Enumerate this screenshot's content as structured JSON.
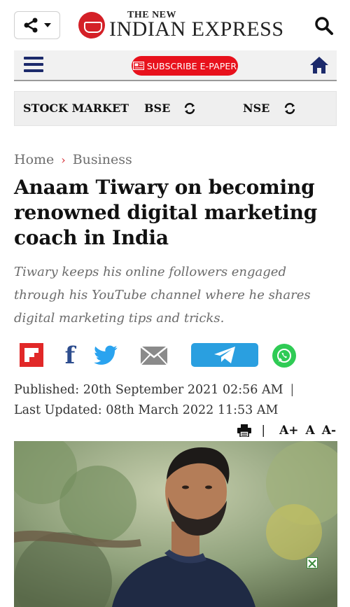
{
  "header": {
    "logo_top": "THE NEW",
    "logo_main": "INDIAN EXPRESS"
  },
  "navbar": {
    "subscribe_label": "SUBSCRIBE E-PAPER"
  },
  "stockbar": {
    "stock_market": "STOCK MARKET",
    "bse": "BSE",
    "nse": "NSE"
  },
  "breadcrumb": {
    "home": "Home",
    "separator": "›",
    "section": "Business"
  },
  "article": {
    "title": "Anaam Tiwary on becoming renowned digital marketing coach in India",
    "subtitle": "Tiwary keeps his online followers engaged through his YouTube channel where he shares digital marketing tips and tricks.",
    "published": "Published: 20th September 2021 02:56 AM",
    "published_sep": "|",
    "updated": "Last Updated: 08th March 2022 11:53 AM"
  },
  "tools": {
    "separator": "|",
    "font_increase": "A+",
    "font_normal": "A",
    "font_decrease": "A-"
  },
  "social": {
    "facebook_glyph": "f"
  },
  "colors": {
    "brand_red": "#d42027",
    "navy": "#1c2a6b",
    "telegram": "#2a9fe0",
    "whatsapp": "#2fcb55"
  }
}
